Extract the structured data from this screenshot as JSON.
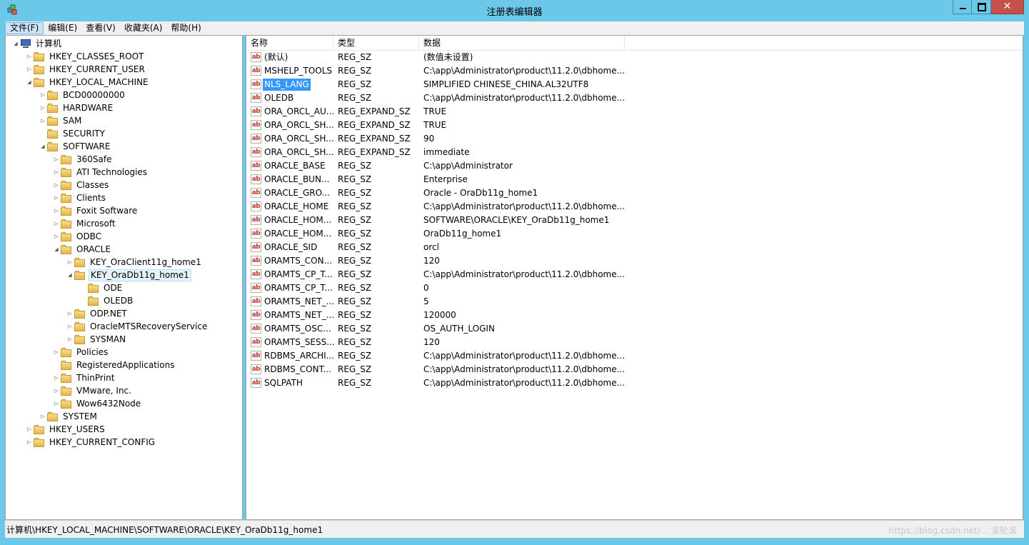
{
  "window": {
    "title": "注册表编辑器",
    "close_glyph": "✕"
  },
  "menu": [
    "文件(F)",
    "编辑(E)",
    "查看(V)",
    "收藏夹(A)",
    "帮助(H)"
  ],
  "tree": {
    "nodes": [
      {
        "label": "计算机",
        "icon": "computer-icon",
        "expander": "◢"
      },
      {
        "label": "HKEY_CLASSES_ROOT",
        "icon": "folder-icon",
        "expander": "▷"
      },
      {
        "label": "HKEY_CURRENT_USER",
        "icon": "folder-icon",
        "expander": "▷"
      },
      {
        "label": "HKEY_LOCAL_MACHINE",
        "icon": "folder-icon",
        "expander": "◢"
      },
      {
        "label": "BCD00000000",
        "icon": "folder-icon",
        "expander": "▷"
      },
      {
        "label": "HARDWARE",
        "icon": "folder-icon",
        "expander": "▷"
      },
      {
        "label": "SAM",
        "icon": "folder-icon",
        "expander": "▷"
      },
      {
        "label": "SECURITY",
        "icon": "folder-icon",
        "expander": ""
      },
      {
        "label": "SOFTWARE",
        "icon": "folder-icon",
        "expander": "◢"
      },
      {
        "label": "360Safe",
        "icon": "folder-icon",
        "expander": "▷"
      },
      {
        "label": "ATI Technologies",
        "icon": "folder-icon",
        "expander": "▷"
      },
      {
        "label": "Classes",
        "icon": "folder-icon",
        "expander": "▷"
      },
      {
        "label": "Clients",
        "icon": "folder-icon",
        "expander": "▷"
      },
      {
        "label": "Foxit Software",
        "icon": "folder-icon",
        "expander": "▷"
      },
      {
        "label": "Microsoft",
        "icon": "folder-icon",
        "expander": "▷"
      },
      {
        "label": "ODBC",
        "icon": "folder-icon",
        "expander": "▷"
      },
      {
        "label": "ORACLE",
        "icon": "folder-icon",
        "expander": "◢"
      },
      {
        "label": "KEY_OraClient11g_home1",
        "icon": "folder-icon",
        "expander": "▷"
      },
      {
        "label": "KEY_OraDb11g_home1",
        "icon": "folder-icon",
        "expander": "◢",
        "selected": true
      },
      {
        "label": "ODE",
        "icon": "folder-icon",
        "expander": ""
      },
      {
        "label": "OLEDB",
        "icon": "folder-icon",
        "expander": ""
      },
      {
        "label": "ODP.NET",
        "icon": "folder-icon",
        "expander": "▷"
      },
      {
        "label": "OracleMTSRecoveryService",
        "icon": "folder-icon",
        "expander": "▷"
      },
      {
        "label": "SYSMAN",
        "icon": "folder-icon",
        "expander": "▷"
      },
      {
        "label": "Policies",
        "icon": "folder-icon",
        "expander": "▷"
      },
      {
        "label": "RegisteredApplications",
        "icon": "folder-icon",
        "expander": ""
      },
      {
        "label": "ThinPrint",
        "icon": "folder-icon",
        "expander": "▷"
      },
      {
        "label": "VMware, Inc.",
        "icon": "folder-icon",
        "expander": "▷"
      },
      {
        "label": "Wow6432Node",
        "icon": "folder-icon",
        "expander": "▷"
      },
      {
        "label": "SYSTEM",
        "icon": "folder-icon",
        "expander": "▷"
      },
      {
        "label": "HKEY_USERS",
        "icon": "folder-icon",
        "expander": "▷"
      },
      {
        "label": "HKEY_CURRENT_CONFIG",
        "icon": "folder-icon",
        "expander": "▷"
      }
    ]
  },
  "list": {
    "headers": [
      "名称",
      "类型",
      "数据"
    ],
    "value_icon_text": "ab",
    "rows": [
      {
        "name": "(默认)",
        "type": "REG_SZ",
        "data": "(数值未设置)"
      },
      {
        "name": "MSHELP_TOOLS",
        "type": "REG_SZ",
        "data": "C:\\app\\Administrator\\product\\11.2.0\\dbhome..."
      },
      {
        "name": "NLS_LANG",
        "type": "REG_SZ",
        "data": "SIMPLIFIED CHINESE_CHINA.AL32UTF8",
        "selected": true
      },
      {
        "name": "OLEDB",
        "type": "REG_SZ",
        "data": "C:\\app\\Administrator\\product\\11.2.0\\dbhome..."
      },
      {
        "name": "ORA_ORCL_AU...",
        "type": "REG_EXPAND_SZ",
        "data": "TRUE"
      },
      {
        "name": "ORA_ORCL_SH...",
        "type": "REG_EXPAND_SZ",
        "data": "TRUE"
      },
      {
        "name": "ORA_ORCL_SH...",
        "type": "REG_EXPAND_SZ",
        "data": "90"
      },
      {
        "name": "ORA_ORCL_SH...",
        "type": "REG_EXPAND_SZ",
        "data": "immediate"
      },
      {
        "name": "ORACLE_BASE",
        "type": "REG_SZ",
        "data": "C:\\app\\Administrator"
      },
      {
        "name": "ORACLE_BUN...",
        "type": "REG_SZ",
        "data": "Enterprise"
      },
      {
        "name": "ORACLE_GRO...",
        "type": "REG_SZ",
        "data": "Oracle - OraDb11g_home1"
      },
      {
        "name": "ORACLE_HOME",
        "type": "REG_SZ",
        "data": "C:\\app\\Administrator\\product\\11.2.0\\dbhome..."
      },
      {
        "name": "ORACLE_HOM...",
        "type": "REG_SZ",
        "data": "SOFTWARE\\ORACLE\\KEY_OraDb11g_home1"
      },
      {
        "name": "ORACLE_HOM...",
        "type": "REG_SZ",
        "data": "OraDb11g_home1"
      },
      {
        "name": "ORACLE_SID",
        "type": "REG_SZ",
        "data": "orcl"
      },
      {
        "name": "ORAMTS_CON...",
        "type": "REG_SZ",
        "data": "120"
      },
      {
        "name": "ORAMTS_CP_T...",
        "type": "REG_SZ",
        "data": "C:\\app\\Administrator\\product\\11.2.0\\dbhome..."
      },
      {
        "name": "ORAMTS_CP_T...",
        "type": "REG_SZ",
        "data": "0"
      },
      {
        "name": "ORAMTS_NET_...",
        "type": "REG_SZ",
        "data": "5"
      },
      {
        "name": "ORAMTS_NET_...",
        "type": "REG_SZ",
        "data": "120000"
      },
      {
        "name": "ORAMTS_OSC...",
        "type": "REG_SZ",
        "data": "OS_AUTH_LOGIN"
      },
      {
        "name": "ORAMTS_SESS...",
        "type": "REG_SZ",
        "data": "120"
      },
      {
        "name": "RDBMS_ARCHI...",
        "type": "REG_SZ",
        "data": "C:\\app\\Administrator\\product\\11.2.0\\dbhome..."
      },
      {
        "name": "RDBMS_CONT...",
        "type": "REG_SZ",
        "data": "C:\\app\\Administrator\\product\\11.2.0\\dbhome..."
      },
      {
        "name": "SQLPATH",
        "type": "REG_SZ",
        "data": "C:\\app\\Administrator\\product\\11.2.0\\dbhome..."
      }
    ]
  },
  "status": {
    "path": "计算机\\HKEY_LOCAL_MACHINE\\SOFTWARE\\ORACLE\\KEY_OraDb11g_home1",
    "watermark": "https://blog.csdn.net/... 滚轮滚"
  },
  "colors": {
    "titlebar": "#6cc8e8",
    "selection": "#3399ff",
    "close_button": "#c7504c"
  }
}
